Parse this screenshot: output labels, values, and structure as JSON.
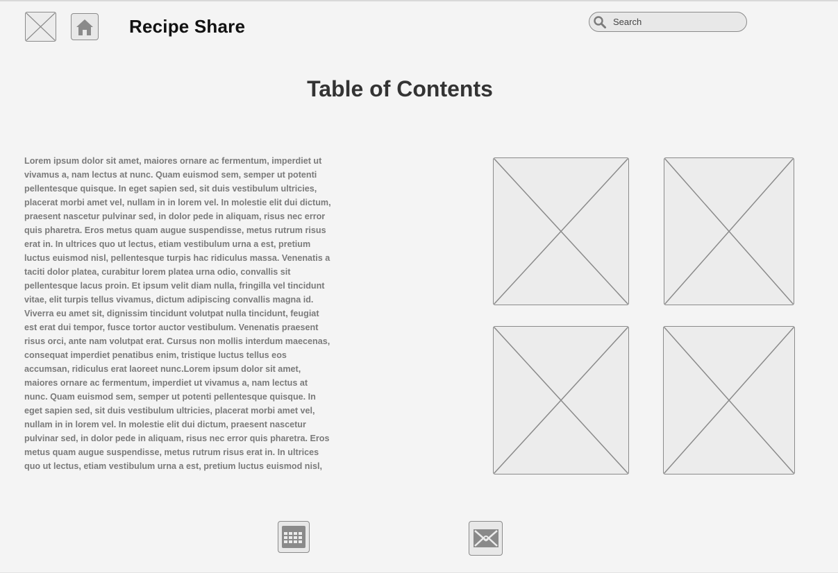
{
  "header": {
    "app_title": "Recipe Share",
    "search": {
      "placeholder": "Search",
      "value": ""
    },
    "icons": {
      "logo": "image-placeholder-icon",
      "home": "home-icon",
      "search": "search-icon"
    }
  },
  "main": {
    "heading": "Table of Contents",
    "body_text": "Lorem ipsum dolor sit amet, maiores ornare ac fermentum, imperdiet ut vivamus a, nam lectus at nunc. Quam euismod sem, semper ut potenti pellentesque quisque. In eget sapien sed, sit duis vestibulum ultricies, placerat morbi amet vel, nullam in in lorem vel. In molestie elit dui dictum, praesent nascetur pulvinar sed, in dolor pede in aliquam, risus nec error quis pharetra. Eros metus quam augue suspendisse, metus rutrum risus erat in. In ultrices quo ut lectus, etiam vestibulum urna a est, pretium luctus euismod nisl, pellentesque turpis hac ridiculus massa. Venenatis a taciti dolor platea, curabitur lorem platea urna odio, convallis sit pellentesque lacus proin. Et ipsum velit diam nulla, fringilla vel tincidunt vitae, elit turpis tellus vivamus, dictum adipiscing convallis magna id. Viverra eu amet sit, dignissim tincidunt volutpat nulla tincidunt, feugiat est erat dui tempor, fusce tortor auctor vestibulum. Venenatis praesent risus orci, ante nam volutpat erat. Cursus non mollis interdum maecenas, consequat imperdiet penatibus enim, tristique luctus tellus eos accumsan, ridiculus erat laoreet nunc.Lorem ipsum dolor sit amet, maiores ornare ac fermentum, imperdiet ut vivamus a, nam lectus at nunc. Quam euismod sem, semper ut potenti pellentesque quisque. In eget sapien sed, sit duis vestibulum ultricies, placerat morbi amet vel, nullam in in lorem vel. In molestie elit dui dictum, praesent nascetur pulvinar sed, in dolor pede in aliquam, risus nec error quis pharetra. Eros metus quam augue suspendisse, metus rutrum risus erat in. In ultrices quo ut lectus, etiam vestibulum urna a est, pretium luctus euismod nisl, pellentesque turpis hac ridiculus massa. Venenatis a taciti",
    "images": [
      "image-placeholder-icon",
      "image-placeholder-icon",
      "image-placeholder-icon",
      "image-placeholder-icon"
    ]
  },
  "footer": {
    "icons": [
      "calendar-icon",
      "mail-icon"
    ]
  },
  "colors": {
    "background": "#f4f4f4",
    "placeholder_fill": "#ececec",
    "stroke": "#8a8a8a",
    "title": "#111111",
    "heading": "#333333",
    "body_text": "#7a7a7a"
  }
}
